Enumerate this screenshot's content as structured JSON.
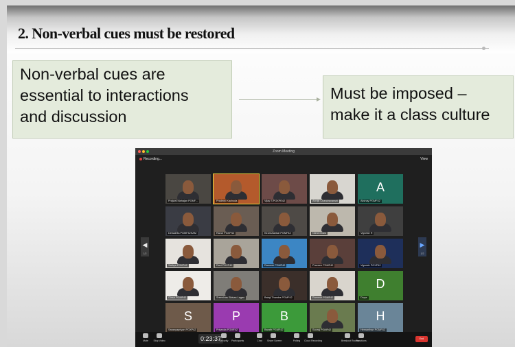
{
  "slide": {
    "title": "2. Non-verbal cues must be restored",
    "left_box": [
      "Non-verbal cues are",
      "essential to interactions",
      "and discussion"
    ],
    "right_box": [
      "Must be imposed –",
      "make it a class culture"
    ]
  },
  "zoom": {
    "window_title": "Zoom Meeting",
    "recording_label": "Recording...",
    "view_label": "View",
    "page_left": "1/2",
    "page_right": "1/2",
    "timer": "0:23:37",
    "end_label": "End",
    "participants": [
      {
        "name": "Prajwal Mahajan PGMF...",
        "letter": "",
        "bg": "#4a4742"
      },
      {
        "name": "Pradeep Kachoda",
        "letter": "",
        "bg": "#b45a2c"
      },
      {
        "name": "Vijay S PGXPE42",
        "letter": "",
        "bg": "#6d4b48"
      },
      {
        "name": "Abhijit Chandravanshi",
        "letter": "",
        "bg": "#d8d6d0"
      },
      {
        "name": "Akshay PGMF42",
        "letter": "A",
        "bg": "#1f6f5e"
      },
      {
        "name": "Debadrita PGMF42KAM",
        "letter": "",
        "bg": "#3a3c44"
      },
      {
        "name": "Ravur PGXP42",
        "letter": "",
        "bg": "#6a5d53"
      },
      {
        "name": "Kiranshankar PGMF42",
        "letter": "",
        "bg": "#4e4a46"
      },
      {
        "name": "Nikhil Bhasi",
        "letter": "",
        "bg": "#bdb8ad"
      },
      {
        "name": "Vignesh R",
        "letter": "",
        "bg": "#3f3f3f"
      },
      {
        "name": "Sathya PGXP42",
        "letter": "",
        "bg": "#e6e3de"
      },
      {
        "name": "Ravi PGXP42",
        "letter": "",
        "bg": "#a9a49a"
      },
      {
        "name": "Ramesh PGMF42",
        "letter": "",
        "bg": "#3c86c4"
      },
      {
        "name": "Praveen PGMF42",
        "letter": "",
        "bg": "#5a3f3a"
      },
      {
        "name": "Vignesh PGXP42",
        "letter": "",
        "bg": "#1e2f5a"
      },
      {
        "name": "Girish PGMF42",
        "letter": "",
        "bg": "#eeece8"
      },
      {
        "name": "Sreenivas Shivan Lagao",
        "letter": "",
        "bg": "#7f7d78"
      },
      {
        "name": "Balaji Thandra PGMF42",
        "letter": "",
        "bg": "#3b2f2a"
      },
      {
        "name": "Ramesh PGMF42",
        "letter": "",
        "bg": "#d9d5cd"
      },
      {
        "name": "Divya",
        "letter": "D",
        "bg": "#3f7f2f"
      },
      {
        "name": "Saranyapriyan PGXP42",
        "letter": "S",
        "bg": "#6e5a4a"
      },
      {
        "name": "Priyanka PGMF42",
        "letter": "P",
        "bg": "#9a3bb0"
      },
      {
        "name": "Barath PGMF42",
        "letter": "B",
        "bg": "#3c9a3a"
      },
      {
        "name": "Sooraj PGMF42",
        "letter": "",
        "bg": "#6a7b4f"
      },
      {
        "name": "Hemanthan PGMF42",
        "letter": "H",
        "bg": "#6a8598"
      }
    ],
    "toolbar": [
      {
        "label": "Mute",
        "icon": "microphone-icon"
      },
      {
        "label": "Stop Video",
        "icon": "camera-icon"
      },
      {
        "label": "Security",
        "icon": "shield-icon"
      },
      {
        "label": "Participants",
        "icon": "participants-icon"
      },
      {
        "label": "Chat",
        "icon": "chat-icon"
      },
      {
        "label": "Share Screen",
        "icon": "share-screen-icon"
      },
      {
        "label": "Polling",
        "icon": "poll-icon"
      },
      {
        "label": "Cloud Recording",
        "icon": "record-icon"
      },
      {
        "label": "Breakout Rooms",
        "icon": "breakout-rooms-icon"
      },
      {
        "label": "Reactions",
        "icon": "reactions-icon"
      }
    ]
  },
  "colors": {
    "slide_box": "#e4ebdc",
    "zoom_bg": "#1f1f1f",
    "active_speaker": "#e8d23a"
  }
}
